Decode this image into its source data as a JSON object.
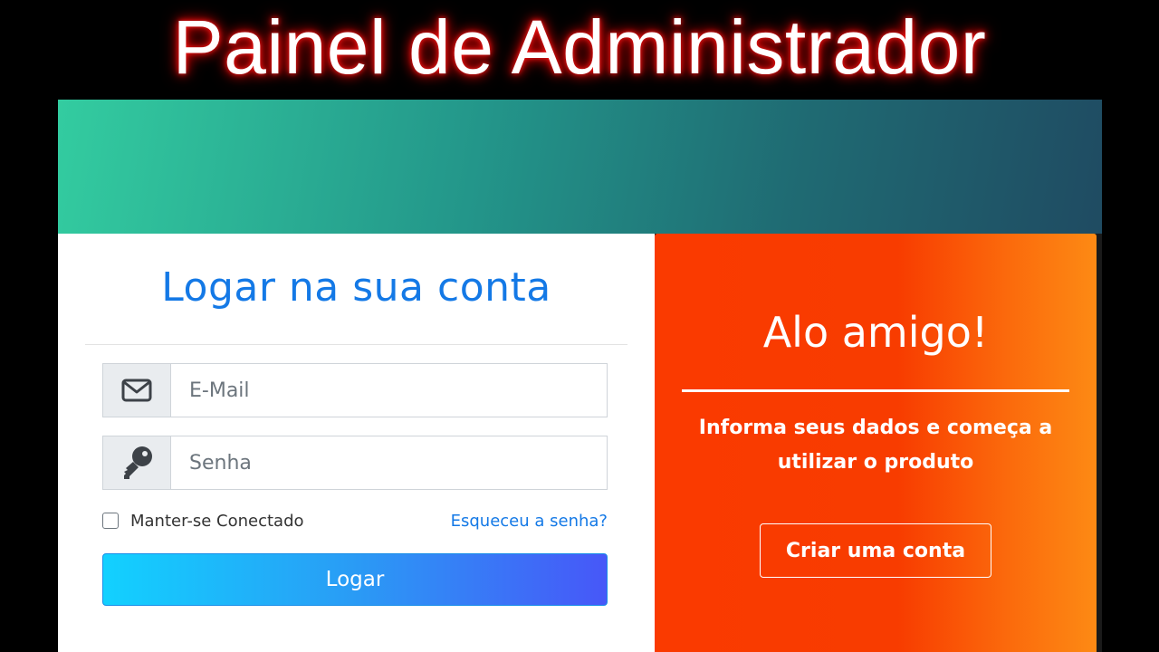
{
  "page_title": "Painel de Administrador",
  "login": {
    "title": "Logar na sua conta",
    "email_placeholder": "E-Mail",
    "email_value": "",
    "email_icon": "envelope-icon",
    "password_placeholder": "Senha",
    "password_value": "",
    "password_icon": "key-icon",
    "remember_label": "Manter-se Conectado",
    "remember_checked": false,
    "forgot_link": "Esqueceu a senha?",
    "submit_label": "Logar"
  },
  "welcome": {
    "title": "Alo amigo!",
    "text": "Informa seus dados e começa a utilizar o produto",
    "signup_label": "Criar uma conta"
  },
  "colors": {
    "title_glow": "#e00000",
    "banner_start": "#33cca0",
    "banner_end": "#1f4b62",
    "login_accent": "#1479e6",
    "button_gradient_start": "#12d1ff",
    "button_gradient_end": "#4757f8",
    "welcome_gradient_start": "#fa3a00",
    "welcome_gradient_end": "#fd8a14"
  }
}
